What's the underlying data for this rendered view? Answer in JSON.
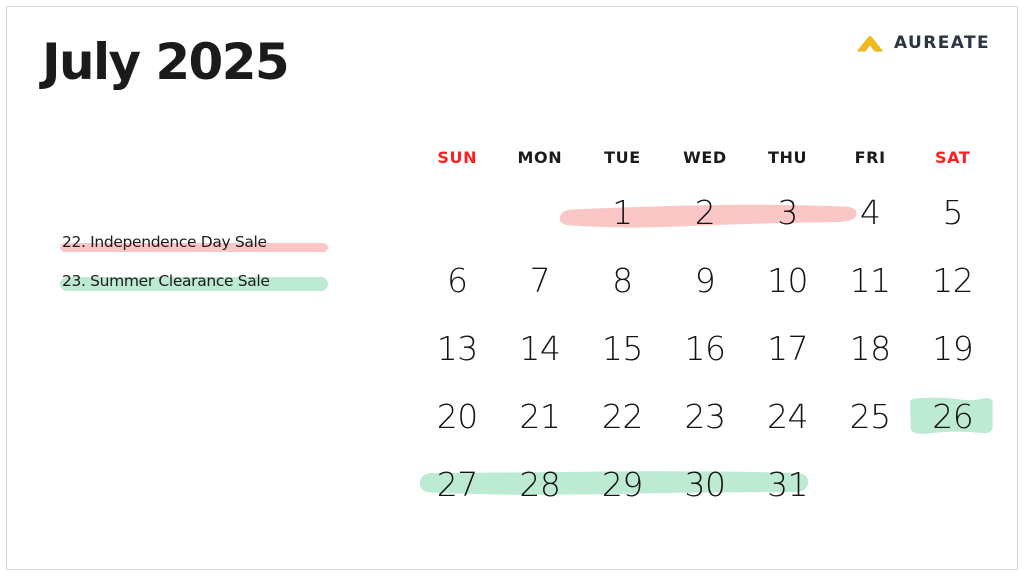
{
  "page": {
    "title": "July 2025",
    "month": "July",
    "year": "2025"
  },
  "brand": {
    "name": "AUREATE",
    "mark_icon": "chevron-up-icon",
    "mark_color": "#edba20",
    "name_color": "#2b3544"
  },
  "legend": {
    "items": [
      {
        "label": "22. Independence Day Sale",
        "highlight_color": "#fbc6c6",
        "style": "underline"
      },
      {
        "label": "23. Summer Clearance Sale",
        "highlight_color": "#bdead3",
        "style": "highlight"
      }
    ]
  },
  "calendar": {
    "day_headers": [
      {
        "label": "SUN",
        "weekend": true
      },
      {
        "label": "MON",
        "weekend": false
      },
      {
        "label": "TUE",
        "weekend": false
      },
      {
        "label": "WED",
        "weekend": false
      },
      {
        "label": "THU",
        "weekend": false
      },
      {
        "label": "FRI",
        "weekend": false
      },
      {
        "label": "SAT",
        "weekend": true
      }
    ],
    "weeks": [
      [
        "",
        "",
        "1",
        "2",
        "3",
        "4",
        "5"
      ],
      [
        "6",
        "7",
        "8",
        "9",
        "10",
        "11",
        "12"
      ],
      [
        "13",
        "14",
        "15",
        "16",
        "17",
        "18",
        "19"
      ],
      [
        "20",
        "21",
        "22",
        "23",
        "24",
        "25",
        "26"
      ],
      [
        "27",
        "28",
        "29",
        "30",
        "31",
        "",
        ""
      ]
    ],
    "highlights": [
      {
        "name": "independence-day-sale-highlight",
        "color": "#fbc6c6",
        "week": 0,
        "start_day": "1",
        "end_day": "4"
      },
      {
        "name": "summer-clearance-sale-highlight-26",
        "color": "#bdead3",
        "week": 3,
        "start_day": "26",
        "end_day": "26"
      },
      {
        "name": "summer-clearance-sale-highlight-27-31",
        "color": "#bdead3",
        "week": 4,
        "start_day": "27",
        "end_day": "31"
      }
    ]
  },
  "colors": {
    "background": "#ffffff",
    "text": "#1b1b1b",
    "weekend": "#ff1f1f",
    "border": "#d6d6d6",
    "pink": "#fbc6c6",
    "green": "#bdead3"
  }
}
